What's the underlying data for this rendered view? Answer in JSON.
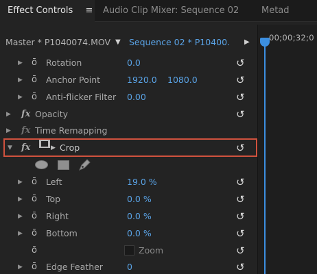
{
  "tabs": [
    {
      "label": "Effect Controls",
      "menu_glyph": "≡",
      "active": true
    },
    {
      "label": "Audio Clip Mixer: Sequence 02",
      "active": false
    },
    {
      "label": "Metad",
      "active": false
    }
  ],
  "header": {
    "master_clip": "Master * P1040074.MOV",
    "sequence_clip": "Sequence 02 * P10400...",
    "timecode": "00;00;32;0"
  },
  "rows": {
    "rotation": {
      "label": "Rotation",
      "value": "0.0"
    },
    "anchor_point": {
      "label": "Anchor Point",
      "x": "1920.0",
      "y": "1080.0"
    },
    "anti_flicker": {
      "label": "Anti-flicker Filter",
      "value": "0.00"
    },
    "opacity": {
      "fx": "fx",
      "label": "Opacity"
    },
    "time_remapping": {
      "fx": "fx",
      "label": "Time Remapping"
    },
    "crop": {
      "fx": "fx",
      "label": "Crop"
    },
    "left": {
      "label": "Left",
      "value": "19.0 %"
    },
    "top": {
      "label": "Top",
      "value": "0.0 %"
    },
    "right": {
      "label": "Right",
      "value": "0.0 %"
    },
    "bottom": {
      "label": "Bottom",
      "value": "0.0 %"
    },
    "zoom": {
      "label": "Zoom",
      "checked": false
    },
    "edge_feather": {
      "label": "Edge Feather",
      "value": "0"
    }
  },
  "glyphs": {
    "expand": "▶",
    "collapse": "▼",
    "stopwatch": "ō",
    "reset": "↺",
    "dropdown": "▼",
    "next": "▶"
  },
  "colors": {
    "value_blue": "#5aa3e6",
    "playhead_blue": "#3c8fe0",
    "highlight_red": "#d0523e",
    "panel_bg": "#232323"
  }
}
